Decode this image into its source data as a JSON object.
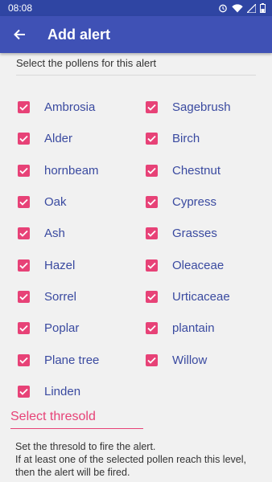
{
  "status_bar": {
    "time": "08:08"
  },
  "app_bar": {
    "title": "Add alert"
  },
  "subtitle": "Select the pollens for this alert",
  "pollens": [
    {
      "label": "Ambrosia",
      "checked": true
    },
    {
      "label": "Sagebrush",
      "checked": true
    },
    {
      "label": "Alder",
      "checked": true
    },
    {
      "label": "Birch",
      "checked": true
    },
    {
      "label": "hornbeam",
      "checked": true
    },
    {
      "label": "Chestnut",
      "checked": true
    },
    {
      "label": "Oak",
      "checked": true
    },
    {
      "label": "Cypress",
      "checked": true
    },
    {
      "label": "Ash",
      "checked": true
    },
    {
      "label": "Grasses",
      "checked": true
    },
    {
      "label": "Hazel",
      "checked": true
    },
    {
      "label": "Oleaceae",
      "checked": true
    },
    {
      "label": "Sorrel",
      "checked": true
    },
    {
      "label": "Urticaceae",
      "checked": true
    },
    {
      "label": "Poplar",
      "checked": true
    },
    {
      "label": "plantain",
      "checked": true
    },
    {
      "label": "Plane tree",
      "checked": true
    },
    {
      "label": "Willow",
      "checked": true
    },
    {
      "label": "Linden",
      "checked": true
    }
  ],
  "threshold": {
    "label": "Select thresold"
  },
  "description": {
    "line1": "Set the thresold to fire the alert.",
    "line2": "If at least one of the selected pollen reach this level, then the alert will be fired."
  },
  "colors": {
    "status_bar": "#2f45a3",
    "app_bar": "#3f51b5",
    "accent": "#e74277",
    "label_text": "#3a4aa0"
  },
  "icons": {
    "back": "arrow-back-icon",
    "alarm": "alarm-icon",
    "wifi": "wifi-icon",
    "signal": "signal-icon",
    "battery": "battery-icon"
  }
}
